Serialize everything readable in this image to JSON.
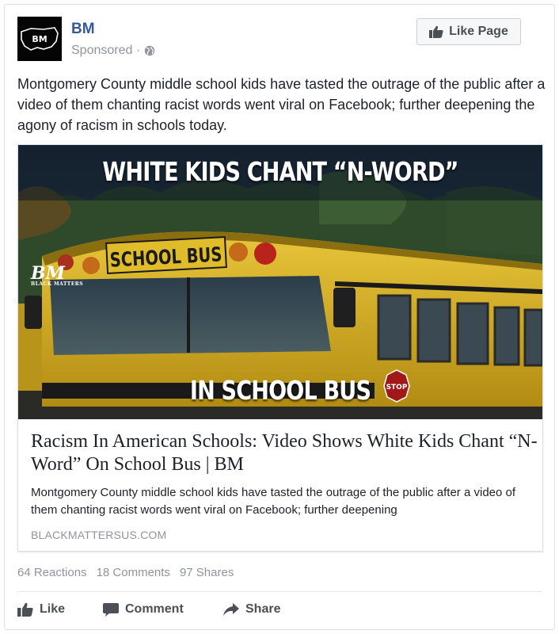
{
  "page": {
    "name": "BM",
    "avatar_text": "BM",
    "sponsored": "Sponsored ·",
    "like_page_label": "Like Page"
  },
  "post": {
    "text": "Montgomery County middle school kids have tasted the outrage of the public after a video of them chanting racist words went viral on Facebook; further deepening the agony of racism in schools today."
  },
  "link": {
    "image_top_text": "WHITE KIDS CHANT “N-WORD”",
    "image_bottom_text": "IN SCHOOL BUS",
    "bus_sign_text": "SCHOOL BUS",
    "stop_sign_text": "STOP",
    "watermark_big": "BM",
    "watermark_small": "BLACK MATTERS",
    "title": "Racism In American Schools: Video Shows White Kids Chant “N-Word” On School Bus | BM",
    "description": "Montgomery County middle school kids have tasted the outrage of the public after a video of them chanting racist words went viral on Facebook; further deepening",
    "domain": "BLACKMATTERSUS.COM"
  },
  "stats": {
    "reactions": "64 Reactions",
    "comments": "18 Comments",
    "shares": "97 Shares"
  },
  "actions": {
    "like": "Like",
    "comment": "Comment",
    "share": "Share"
  },
  "colors": {
    "brand_link": "#365899",
    "muted": "#90949c",
    "bus_yellow": "#d9b21f"
  }
}
